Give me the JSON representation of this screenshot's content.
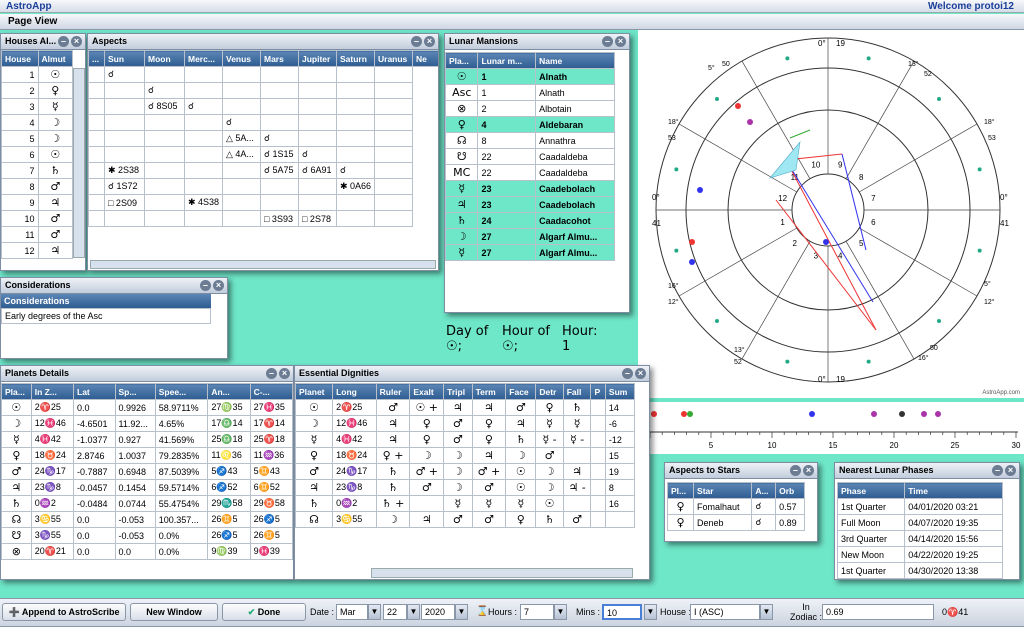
{
  "app": {
    "title": "AstroApp",
    "welcome": "Welcome protoi12",
    "page_view": "Page View"
  },
  "houses": {
    "title": "Houses Al...",
    "headers": [
      "House",
      "Almut"
    ],
    "rows": [
      [
        "1",
        "☉"
      ],
      [
        "2",
        "♀"
      ],
      [
        "3",
        "☿"
      ],
      [
        "4",
        "☽"
      ],
      [
        "5",
        "☽"
      ],
      [
        "6",
        "☉"
      ],
      [
        "7",
        "♄"
      ],
      [
        "8",
        "♂"
      ],
      [
        "9",
        "♃"
      ],
      [
        "10",
        "♂"
      ],
      [
        "11",
        "♂"
      ],
      [
        "12",
        "♃"
      ]
    ]
  },
  "aspects": {
    "title": "Aspects",
    "headers": [
      "...",
      "Sun",
      "Moon",
      "Merc...",
      "Venus",
      "Mars",
      "Jupiter",
      "Saturn",
      "Uranus",
      "Ne"
    ],
    "rows": [
      [
        "",
        "☌",
        "",
        "",
        "",
        "",
        "",
        "",
        ""
      ],
      [
        "",
        "",
        "☌",
        "",
        "",
        "",
        "",
        "",
        ""
      ],
      [
        "",
        "",
        "☌ 8S05",
        "☌",
        "",
        "",
        "",
        "",
        ""
      ],
      [
        "",
        "",
        "",
        "",
        "☌",
        "",
        "",
        "",
        ""
      ],
      [
        "",
        "",
        "",
        "",
        "△ 5A...",
        "☌",
        "",
        "",
        ""
      ],
      [
        "",
        "",
        "",
        "",
        "△ 4A...",
        "☌ 1S15",
        "☌",
        "",
        ""
      ],
      [
        "",
        "✱ 2S38",
        "",
        "",
        "",
        "☌ 5A75",
        "☌ 6A91",
        "☌",
        ""
      ],
      [
        "",
        "☌ 1S72",
        "",
        "",
        "",
        "",
        "",
        "✱ 0A66",
        ""
      ],
      [
        "",
        "□ 2S09",
        "",
        "✱ 4S38",
        "",
        "",
        "",
        "",
        ""
      ],
      [
        "",
        "",
        "",
        "",
        "",
        "□ 3S93",
        "□ 2S78",
        "",
        ""
      ]
    ]
  },
  "considerations": {
    "title": "Considerations",
    "header": "Considerations",
    "items": [
      "Early degrees of the Asc"
    ]
  },
  "lunar": {
    "title": "Lunar Mansions",
    "headers": [
      "Pla...",
      "Lunar m...",
      "Name"
    ],
    "rows": [
      {
        "p": "☉",
        "n": "1",
        "name": "Alnath",
        "hl": true
      },
      {
        "p": "Asc",
        "n": "1",
        "name": "Alnath",
        "hl": false
      },
      {
        "p": "⊗",
        "n": "2",
        "name": "Albotain",
        "hl": false
      },
      {
        "p": "♀",
        "n": "4",
        "name": "Aldebaran",
        "hl": true
      },
      {
        "p": "☊",
        "n": "8",
        "name": "Annathra",
        "hl": false
      },
      {
        "p": "☋",
        "n": "22",
        "name": "Caadaldeba",
        "hl": false
      },
      {
        "p": "MC",
        "n": "22",
        "name": "Caadaldeba",
        "hl": false
      },
      {
        "p": "☿",
        "n": "23",
        "name": "Caadebolach",
        "hl": true
      },
      {
        "p": "♃",
        "n": "23",
        "name": "Caadebolach",
        "hl": true
      },
      {
        "p": "♄",
        "n": "24",
        "name": "Caadacohot",
        "hl": true
      },
      {
        "p": "☽",
        "n": "27",
        "name": "Algarf Almu...",
        "hl": true
      },
      {
        "p": "☿",
        "n": "27",
        "name": "Algarf Almu...",
        "hl": true
      }
    ]
  },
  "day": {
    "day_label": "Day of",
    "day_sym": "☉;",
    "hour_label": "Hour of",
    "hour_sym": "☉;",
    "hours_label": "Hour:",
    "hours_val": "1"
  },
  "planets": {
    "title": "Planets Details",
    "headers": [
      "Pla...",
      "In Z...",
      "Lat",
      "Sp...",
      "Spee...",
      "An...",
      "C-..."
    ],
    "rows": [
      [
        "☉",
        "2♈25",
        "0.0",
        "0.9926",
        "58.9711%",
        "27♍35",
        "27♓35"
      ],
      [
        "☽",
        "12♓46",
        "-4.6501",
        "11.92...",
        "4.65%",
        "17♎14",
        "17♈14"
      ],
      [
        "☿",
        "4♓42",
        "-1.0377",
        "0.927",
        "41.569%",
        "25♎18",
        "25♈18"
      ],
      [
        "♀",
        "18♉24",
        "2.8746",
        "1.0037",
        "79.2835%",
        "11♌36",
        "11♒36"
      ],
      [
        "♂",
        "24♑17",
        "-0.7887",
        "0.6948",
        "87.5039%",
        "5♐43",
        "5♊43"
      ],
      [
        "♃",
        "23♑8",
        "-0.0457",
        "0.1454",
        "59.5714%",
        "6♐52",
        "6♊52"
      ],
      [
        "♄",
        "0♒2",
        "-0.0484",
        "0.0744",
        "55.4754%",
        "29♏58",
        "29♉58"
      ],
      [
        "☊",
        "3♋55",
        "0.0",
        "-0.053",
        "100.357...",
        "26♊5",
        "26♐5"
      ],
      [
        "☋",
        "3♑55",
        "0.0",
        "-0.053",
        "0.0%",
        "26♐5",
        "26♊5"
      ],
      [
        "⊗",
        "20♈21",
        "0.0",
        "0.0",
        "0.0%",
        "9♍39",
        "9♓39"
      ]
    ]
  },
  "dignities": {
    "title": "Essential Dignities",
    "headers": [
      "Planet",
      "Long",
      "Ruler",
      "Exalt",
      "Tripl",
      "Term",
      "Face",
      "Detr",
      "Fall",
      "P",
      "Sum"
    ],
    "rows": [
      [
        "☉",
        "2♈25",
        "♂",
        "☉ +",
        "♃",
        "♃",
        "♂",
        "♀",
        "♄",
        "",
        "14"
      ],
      [
        "☽",
        "12♓46",
        "♃",
        "♀",
        "♂",
        "♀",
        "♃",
        "☿",
        "☿",
        "",
        "-6"
      ],
      [
        "☿",
        "4♓42",
        "♃",
        "♀",
        "♂",
        "♀",
        "♄",
        "☿ -",
        "☿ -",
        "",
        "-12"
      ],
      [
        "♀",
        "18♉24",
        "♀ +",
        "☽",
        "☽",
        "♃",
        "☽",
        "♂",
        "",
        "",
        "15"
      ],
      [
        "♂",
        "24♑17",
        "♄",
        "♂ +",
        "☽",
        "♂ +",
        "☉",
        "☽",
        "♃",
        "",
        "19"
      ],
      [
        "♃",
        "23♑8",
        "♄",
        "♂",
        "☽",
        "♂",
        "☉",
        "☽",
        "♃ -",
        "",
        "8"
      ],
      [
        "♄",
        "0♒2",
        "♄ +",
        "",
        "☿",
        "☿",
        "☿",
        "☉",
        "",
        "",
        "16"
      ],
      [
        "☊",
        "3♋55",
        "☽",
        "♃",
        "♂",
        "♂",
        "♀",
        "♄",
        "♂",
        "",
        ""
      ]
    ]
  },
  "aspects_stars": {
    "title": "Aspects to Stars",
    "headers": [
      "Pl...",
      "Star",
      "A...",
      "Orb"
    ],
    "rows": [
      [
        "♀",
        "Fomalhaut",
        "☌",
        "0.57"
      ],
      [
        "♀",
        "Deneb",
        "☌",
        "0.89"
      ]
    ]
  },
  "phases": {
    "title": "Nearest Lunar Phases",
    "headers": [
      "Phase",
      "Time"
    ],
    "rows": [
      [
        "1st Quarter",
        "04/01/2020 03:21"
      ],
      [
        "Full Moon",
        "04/07/2020 19:35"
      ],
      [
        "3rd Quarter",
        "04/14/2020 15:56"
      ],
      [
        "New Moon",
        "04/22/2020 19:25"
      ],
      [
        "1st Quarter",
        "04/30/2020 13:38"
      ]
    ]
  },
  "toolbar": {
    "append": "Append to AstroScribe",
    "new_window": "New Window",
    "done": "Done",
    "date_label": "Date :",
    "month": "Mar",
    "day": "22",
    "year": "2020",
    "hours_label": "Hours :",
    "hours": "7",
    "mins_label": "Mins :",
    "mins": "10",
    "house_label": "House :",
    "house": "I (ASC)",
    "zodiac_label": "In Zodiac :",
    "zodiac": "0.69",
    "zodiac_pos": "0♈41"
  },
  "chart": {
    "credit": "AstroApp.com",
    "mc": "0°",
    "mc2": "19",
    "ic": "0°",
    "ic2": "19",
    "asc": "0°",
    "asc2": "41",
    "dsc": "0°",
    "dsc2": "41",
    "cusps": [
      "13°",
      "52",
      "18°",
      "53",
      "5°",
      "12°",
      "13°",
      "52",
      "16°",
      "50",
      "5°",
      "50",
      "16°",
      "12°",
      "18°",
      "53"
    ],
    "houses": [
      "1",
      "2",
      "3",
      "4",
      "5",
      "6",
      "7",
      "8",
      "9",
      "10",
      "11",
      "12"
    ],
    "strip_ticks": [
      "5",
      "10",
      "15",
      "20",
      "25",
      "30"
    ]
  }
}
